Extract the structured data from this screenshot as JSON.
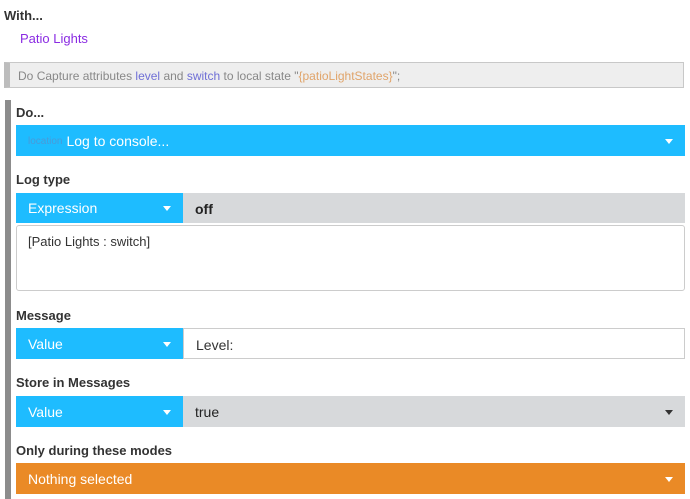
{
  "with_section": {
    "label": "With...",
    "device": "Patio Lights"
  },
  "capture_statement": {
    "do_word": "Do",
    "text_before": "Capture attributes",
    "attr1": "level",
    "and_word": "and",
    "attr2": "switch",
    "text_mid": "to local state",
    "var_quote_open": "\"",
    "var_name": "{patioLightStates}",
    "var_quote_close": "\";"
  },
  "do_section": {
    "label": "Do...",
    "command_prefix": "location",
    "command_value": "Log to console..."
  },
  "log_type": {
    "label": "Log type",
    "operand_type": "Expression",
    "evaluated_value": "off",
    "expression": "[Patio Lights : switch]"
  },
  "message": {
    "label": "Message",
    "operand_type": "Value",
    "value": "Level:"
  },
  "store_in_messages": {
    "label": "Store in Messages",
    "operand_type": "Value",
    "value": "true"
  },
  "only_during_modes": {
    "label": "Only during these modes",
    "value": "Nothing selected"
  },
  "colors": {
    "accent_blue": "#1ebcff",
    "accent_orange": "#ea8a26",
    "device_purple": "#8a2be2",
    "attribute_blue": "#6f6fd6",
    "variable_orange": "#e0a46a"
  },
  "icons": {
    "dropdown": "chevron-down-icon"
  }
}
